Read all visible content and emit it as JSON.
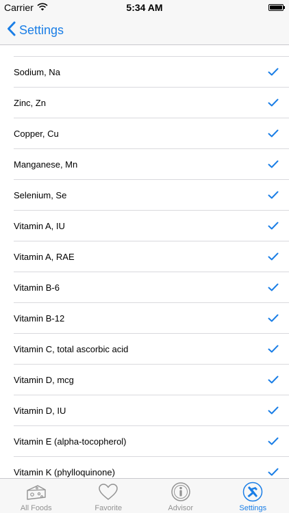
{
  "status_bar": {
    "carrier": "Carrier",
    "time": "5:34 AM"
  },
  "nav": {
    "back_label": "Settings"
  },
  "list": {
    "items": [
      {
        "label": "Sodium, Na",
        "checked": true
      },
      {
        "label": "Zinc, Zn",
        "checked": true
      },
      {
        "label": "Copper, Cu",
        "checked": true
      },
      {
        "label": "Manganese, Mn",
        "checked": true
      },
      {
        "label": "Selenium, Se",
        "checked": true
      },
      {
        "label": "Vitamin A, IU",
        "checked": true
      },
      {
        "label": "Vitamin A, RAE",
        "checked": true
      },
      {
        "label": "Vitamin B-6",
        "checked": true
      },
      {
        "label": "Vitamin B-12",
        "checked": true
      },
      {
        "label": "Vitamin C, total ascorbic acid",
        "checked": true
      },
      {
        "label": "Vitamin D, mcg",
        "checked": true
      },
      {
        "label": "Vitamin D, IU",
        "checked": true
      },
      {
        "label": "Vitamin E (alpha-tocopherol)",
        "checked": true
      },
      {
        "label": "Vitamin K (phylloquinone)",
        "checked": true
      }
    ]
  },
  "tab_bar": {
    "tabs": [
      {
        "label": "All Foods",
        "icon": "cheese-icon",
        "active": false
      },
      {
        "label": "Favorite",
        "icon": "heart-icon",
        "active": false
      },
      {
        "label": "Advisor",
        "icon": "info-circle-icon",
        "active": false
      },
      {
        "label": "Settings",
        "icon": "tools-icon",
        "active": true
      }
    ]
  },
  "colors": {
    "accent": "#1a7ee6",
    "inactive": "#929292",
    "bar_background": "#f7f7f7",
    "separator": "#d9d9dd"
  }
}
